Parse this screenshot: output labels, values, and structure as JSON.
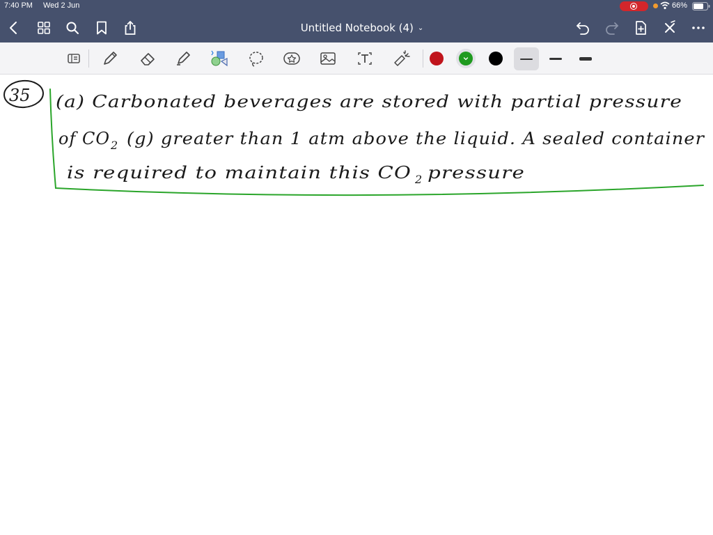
{
  "status_bar": {
    "time": "7:40 PM",
    "date": "Wed 2 Jun",
    "battery": "66%",
    "recording_color": "#d3262b"
  },
  "nav_bar": {
    "title": "Untitled Notebook (4)",
    "icons": [
      "back-icon",
      "grid-icon",
      "search-icon",
      "bookmark-icon",
      "share-icon",
      "undo-icon",
      "redo-icon",
      "add-page-icon",
      "close-icon",
      "more-icon"
    ],
    "background": "#46516d"
  },
  "toolbar": {
    "tools": [
      "reader-mode-icon",
      "pen-icon",
      "eraser-icon",
      "highlighter-icon",
      "shapes-icon",
      "lasso-icon",
      "sticker-icon",
      "image-icon",
      "text-icon",
      "laser-pointer-icon"
    ],
    "colors": [
      "#c0141c",
      "#1f9a1f",
      "#000000"
    ],
    "selected_color": "#1f9a1f",
    "stroke_widths": [
      "thin",
      "medium",
      "thick"
    ],
    "selected_stroke": "thin"
  },
  "note": {
    "question_number": "35",
    "line1": "(a) Carbonated beverages are stored with partial pressure",
    "line2_part1": "of CO",
    "line2_sub": "2",
    "line2_part2": "(g) greater than 1 atm above the liquid. A sealed container",
    "line3_part1": "is required to maintain this CO",
    "line3_sub": "2",
    "line3_part2": " pressure",
    "bracket_color": "#2aa52a"
  }
}
